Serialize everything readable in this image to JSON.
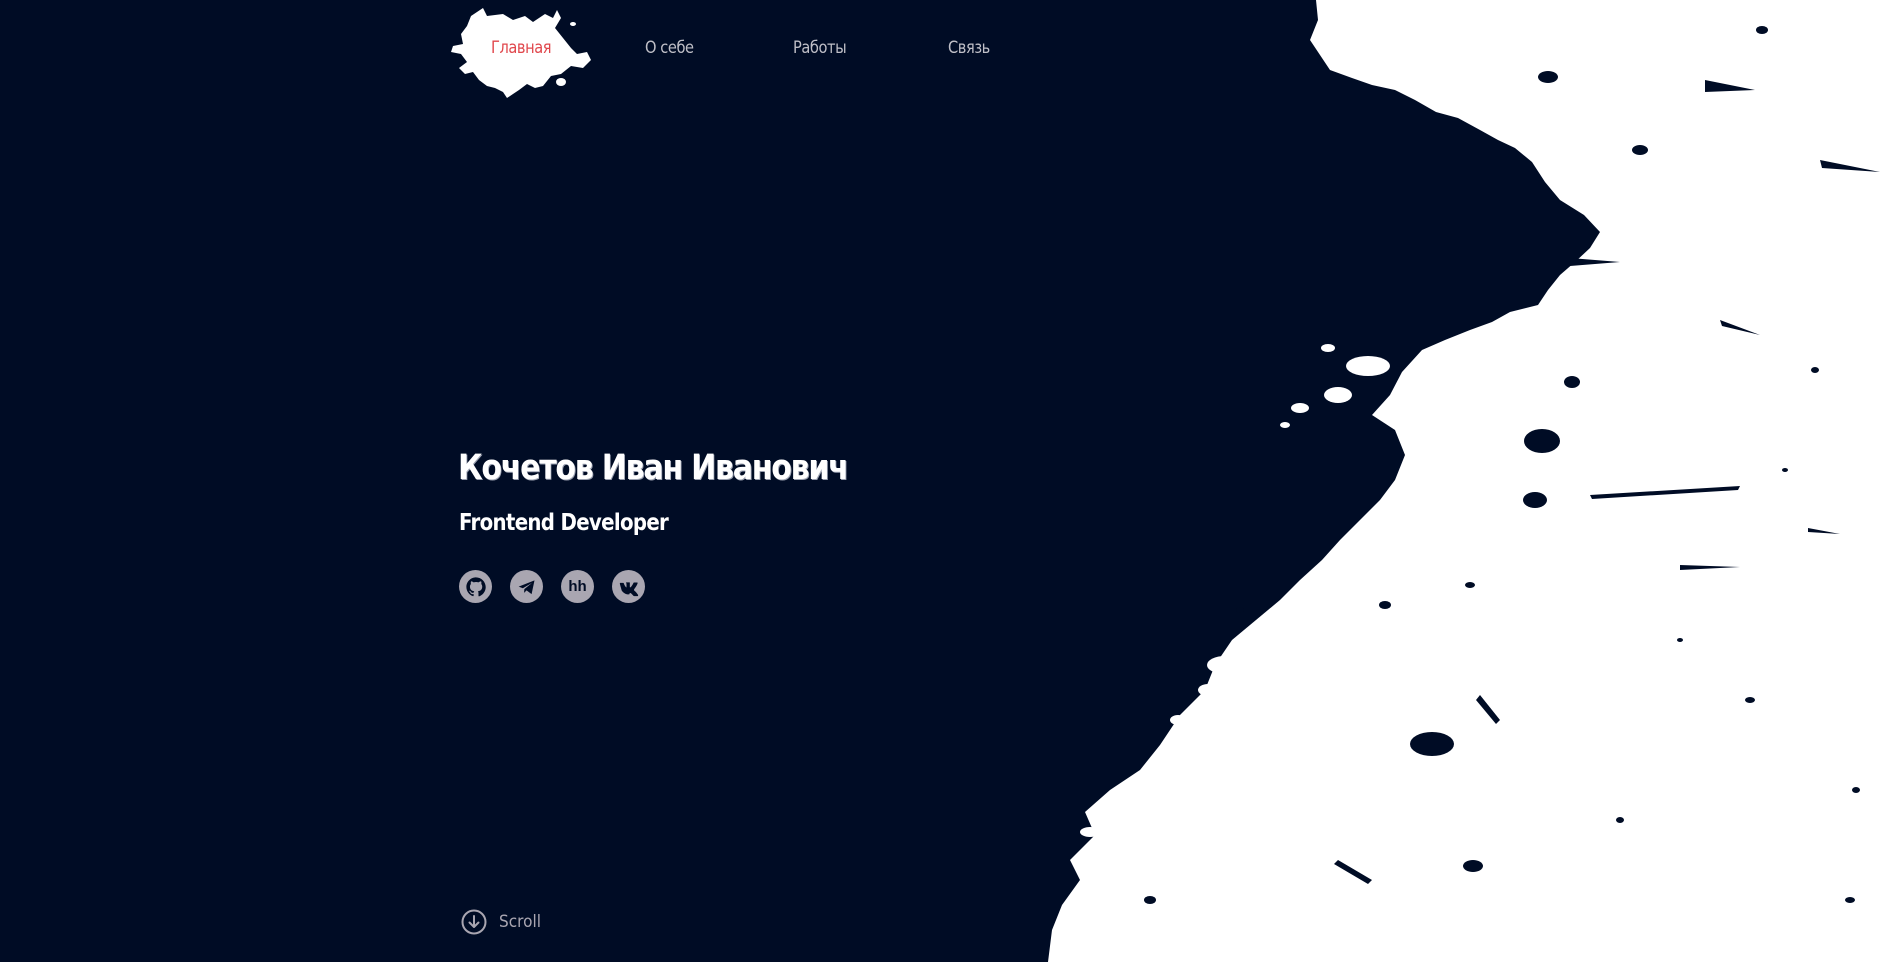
{
  "nav": {
    "items": [
      {
        "label": "Главная",
        "active": true
      },
      {
        "label": "О себе",
        "active": false
      },
      {
        "label": "Работы",
        "active": false
      },
      {
        "label": "Связь",
        "active": false
      }
    ]
  },
  "hero": {
    "name": "Кочетов Иван Иванович",
    "role": "Frontend Developer",
    "socials": [
      {
        "icon": "github-icon"
      },
      {
        "icon": "telegram-icon"
      },
      {
        "icon": "hh-icon",
        "text": "hh"
      },
      {
        "icon": "vk-icon"
      }
    ]
  },
  "scroll": {
    "label": "Scroll"
  },
  "colors": {
    "background": "#000c25",
    "accent": "#e0474c",
    "nav_text": "#bfbfc7",
    "social_bg": "#a9a6b1",
    "splash": "#ffffff"
  }
}
